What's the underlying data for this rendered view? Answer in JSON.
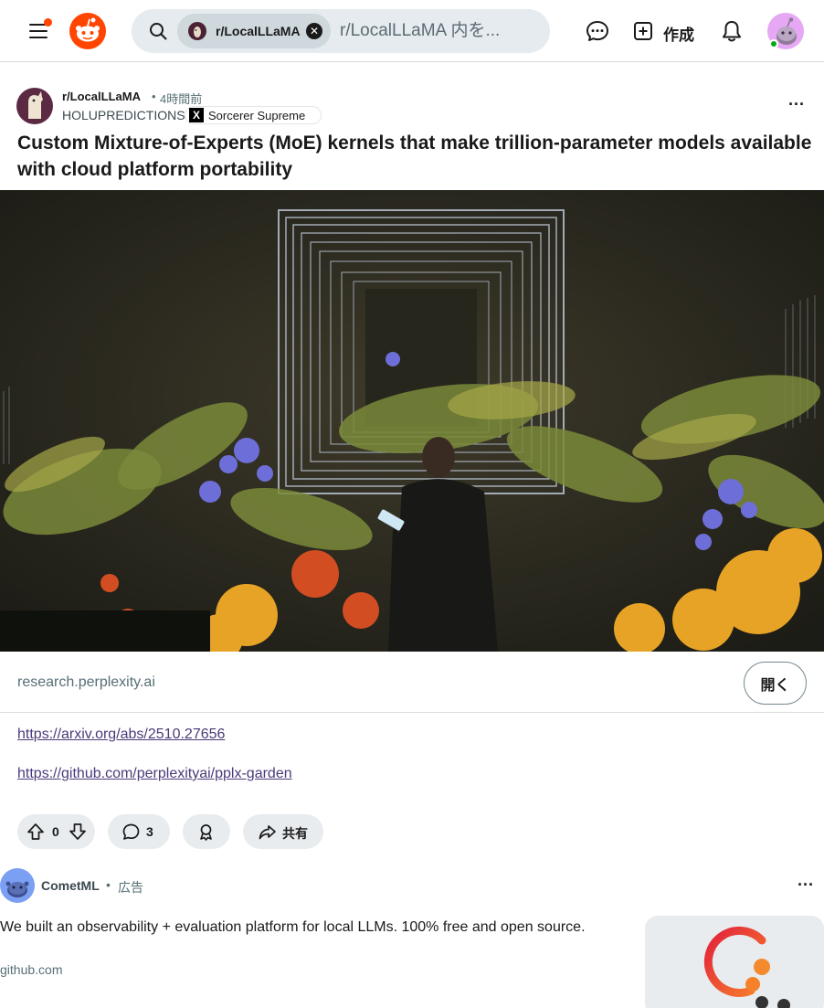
{
  "header": {
    "menu_icon": "hamburger-menu-icon",
    "logo": "reddit-logo",
    "search": {
      "chip_label": "r/LocalLLaMA",
      "placeholder": "r/LocalLLaMA 内を..."
    },
    "chat_icon": "chat-bubble-icon",
    "create_label": "作成",
    "notifications_icon": "bell-icon",
    "accent_color": "#ff4500"
  },
  "post": {
    "subreddit": "r/LocalLLaMA",
    "time": "4時間前",
    "author": "HOLUPREDICTIONS",
    "flair": "Sorcerer Supreme",
    "title": "Custom Mixture-of-Experts (MoE) kernels that make trillion-parameter models available with cloud platform portability",
    "domain": "research.perplexity.ai",
    "open_label": "開く",
    "links": [
      "https://arxiv.org/abs/2510.27656",
      "https://github.com/perplexityai/pplx-garden"
    ],
    "votes": "0",
    "comments": "3",
    "share_label": "共有"
  },
  "ad": {
    "advertiser": "CometML",
    "tag": "広告",
    "text": "We built an observability + evaluation platform for local LLMs. 100% free and open source.",
    "domain": "github.com"
  }
}
